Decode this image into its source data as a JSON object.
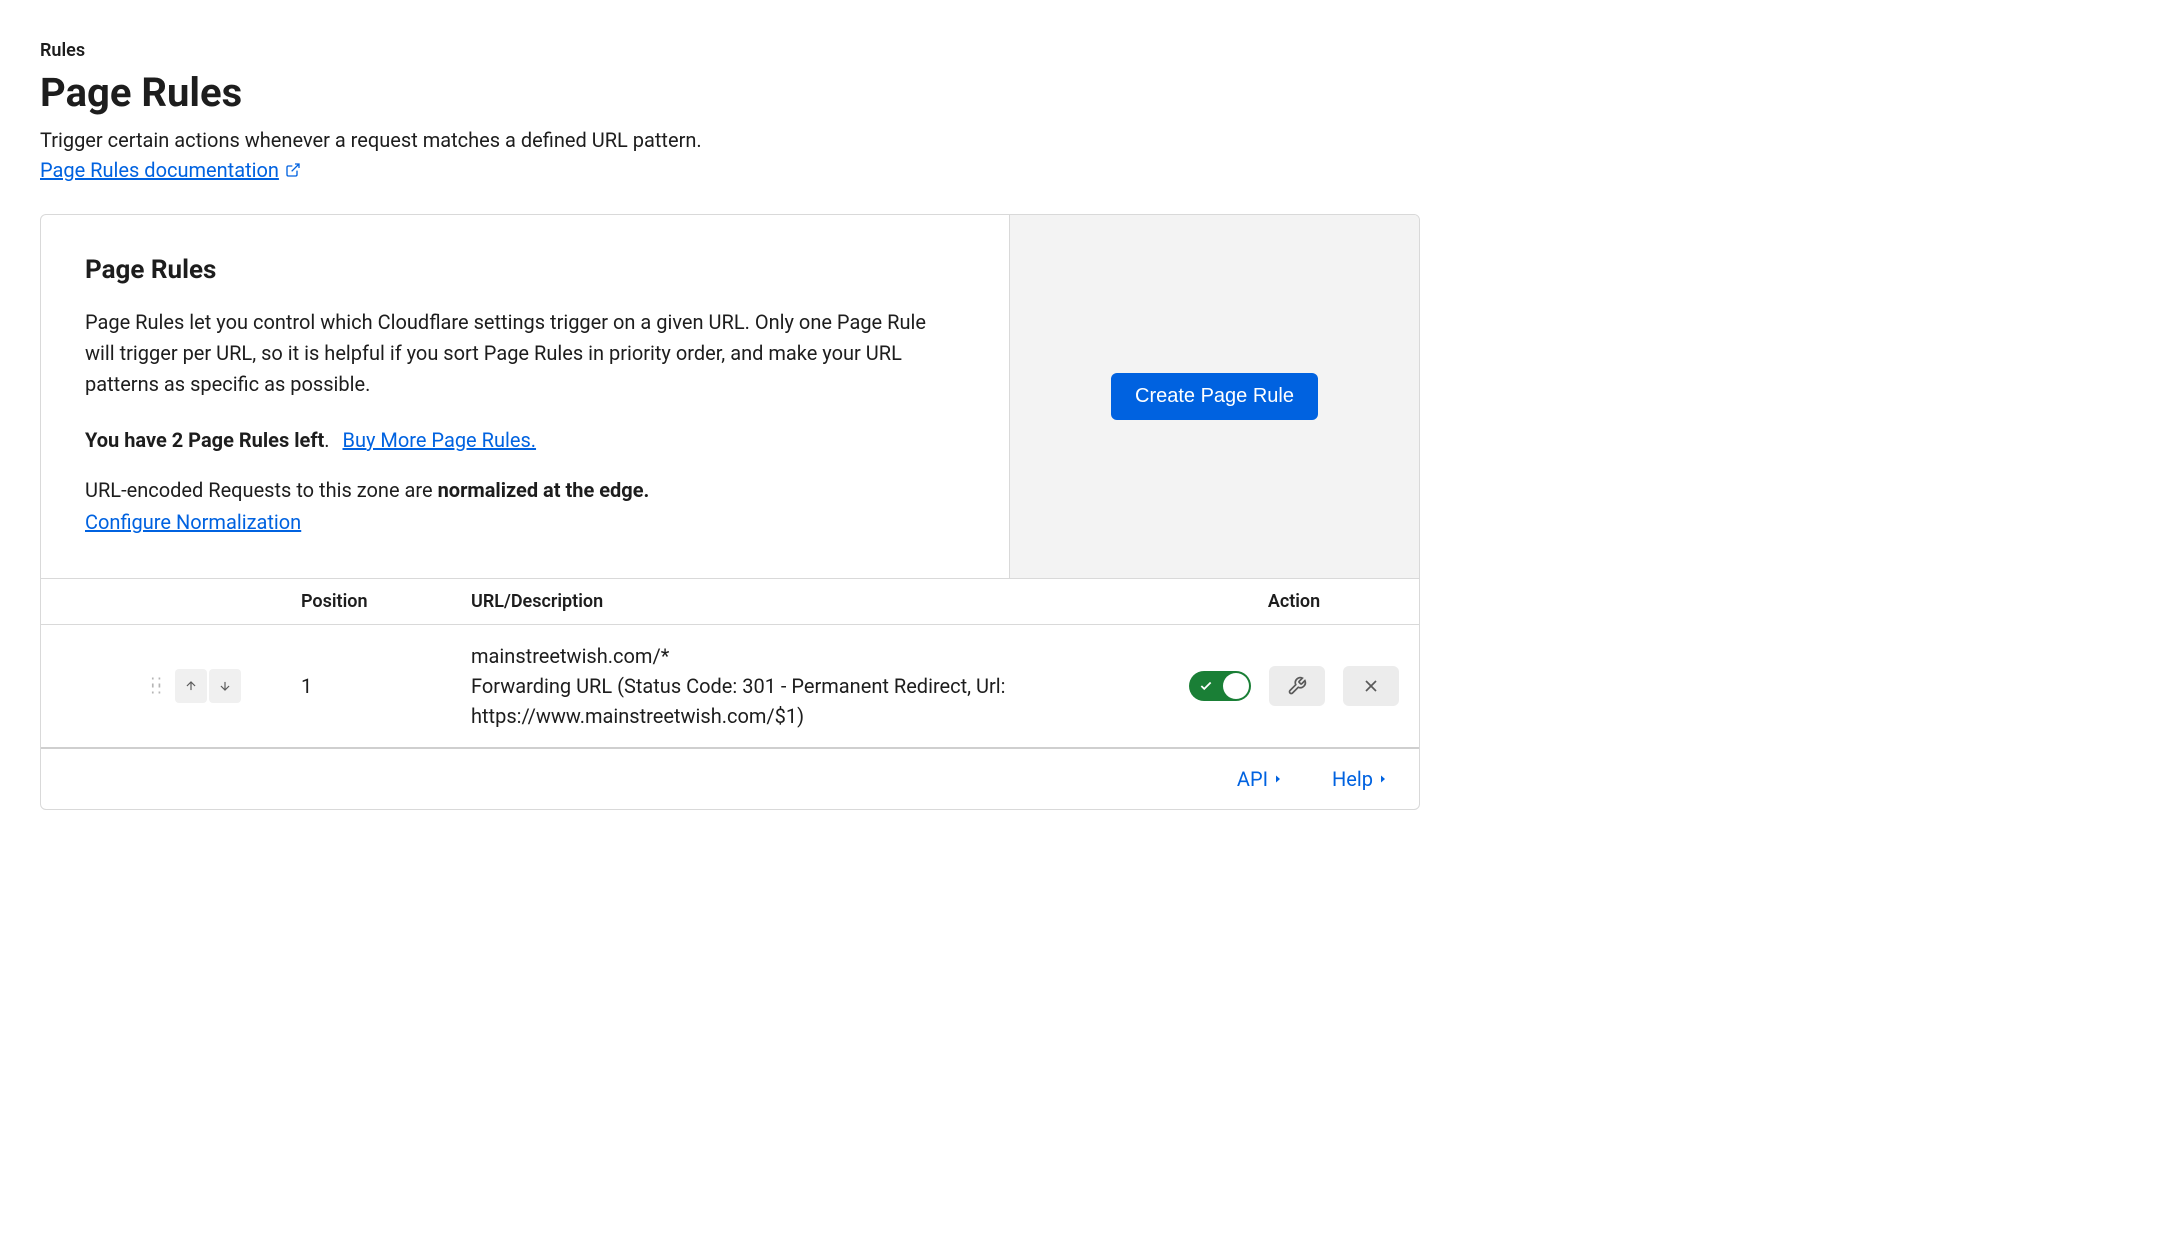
{
  "breadcrumb": "Rules",
  "page_title": "Page Rules",
  "page_subtitle": "Trigger certain actions whenever a request matches a defined URL pattern.",
  "doc_link_label": "Page Rules documentation",
  "card": {
    "section_title": "Page Rules",
    "section_desc": "Page Rules let you control which Cloudflare settings trigger on a given URL. Only one Page Rule will trigger per URL, so it is helpful if you sort Page Rules in priority order, and make your URL patterns as specific as possible.",
    "rules_left_bold": "You have 2 Page Rules left",
    "rules_left_period": ".",
    "buy_more_label": "Buy More Page Rules.",
    "normalize_prefix": "URL-encoded Requests to this zone are ",
    "normalize_bold": "normalized at the edge.",
    "configure_normalization_label": "Configure Normalization",
    "create_button_label": "Create Page Rule"
  },
  "table": {
    "headers": {
      "position": "Position",
      "url": "URL/Description",
      "action": "Action"
    },
    "rows": [
      {
        "position": "1",
        "url": "mainstreetwish.com/*",
        "description": "Forwarding URL (Status Code: 301 - Permanent Redirect, Url: https://www.mainstreetwish.com/$1)",
        "enabled": true
      }
    ]
  },
  "footer": {
    "api_label": "API",
    "help_label": "Help"
  }
}
